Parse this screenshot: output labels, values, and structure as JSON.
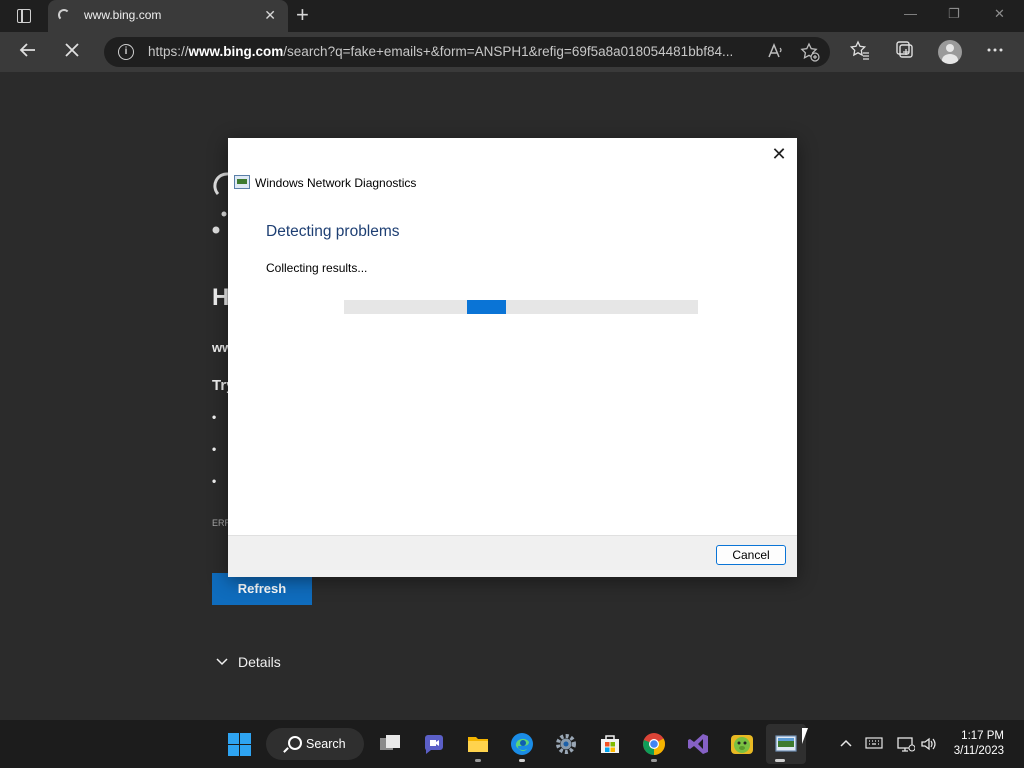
{
  "browser": {
    "tab_title": "www.bing.com",
    "tab_close": "✕",
    "new_tab": "+",
    "url_prefix": "https://",
    "url_host": "www.bing.com",
    "url_rest": "/search?q=fake+emails+&form=ANSPH1&refig=69f5a8a018054481bbf84...",
    "window_controls": {
      "minimize": "—",
      "restore": "❐",
      "close": "✕"
    }
  },
  "page": {
    "fragments": [
      "H",
      "ww",
      "Try",
      "•",
      "•",
      "•",
      "ERR"
    ],
    "refresh_label": "Refresh",
    "details_label": "Details"
  },
  "dialog": {
    "app_title": "Windows Network Diagnostics",
    "heading": "Detecting problems",
    "status": "Collecting results...",
    "cancel_label": "Cancel",
    "close_glyph": "✕"
  },
  "taskbar": {
    "search_label": "Search",
    "time": "1:17 PM",
    "date": "3/11/2023"
  },
  "colors": {
    "accent": "#0a74d6",
    "refresh_button": "#0f6cbd",
    "dialog_heading": "#1e3f73",
    "page_bg": "#2b2b2b"
  }
}
